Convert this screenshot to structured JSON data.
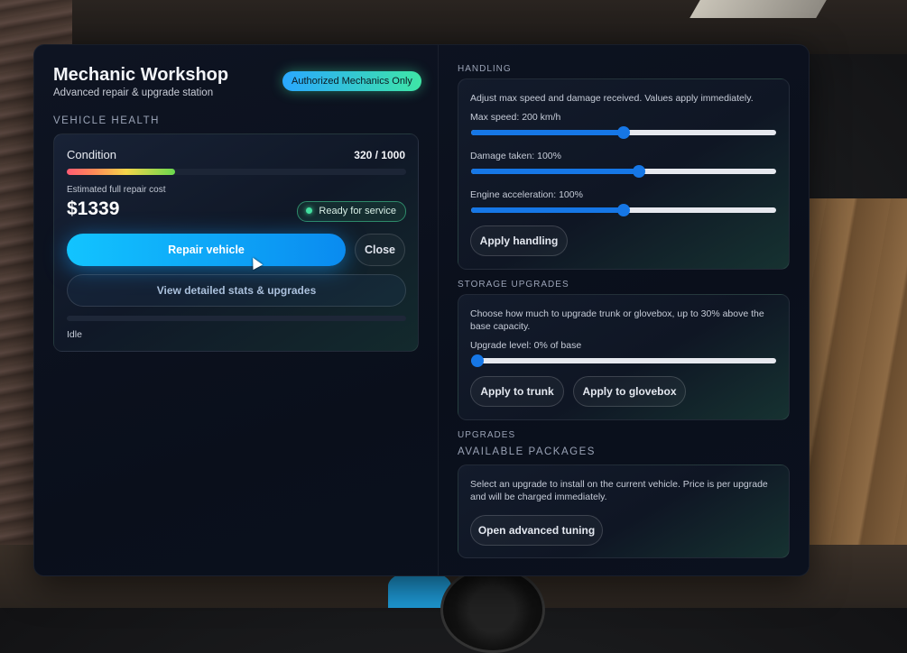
{
  "header": {
    "title": "Mechanic Workshop",
    "subtitle": "Advanced repair & upgrade station",
    "auth_badge": "Authorized Mechanics Only"
  },
  "vehicle_health": {
    "section_label": "VEHICLE HEALTH",
    "condition_label": "Condition",
    "condition_value": "320 / 1000",
    "condition_fraction": 0.32,
    "cost_label": "Estimated full repair cost",
    "cost_value": "$1339",
    "ready_badge": "Ready for service",
    "repair_button": "Repair vehicle",
    "close_button": "Close",
    "details_button": "View detailed stats & upgrades",
    "progress_fraction": 0.0,
    "status": "Idle"
  },
  "handling": {
    "section_label": "HANDLING",
    "close_glyph": "×",
    "description": "Adjust max speed and damage received. Values apply immediately.",
    "sliders": [
      {
        "label": "Max speed: 200 km/h",
        "fraction": 0.5
      },
      {
        "label": "Damage taken: 100%",
        "fraction": 0.55
      },
      {
        "label": "Engine acceleration: 100%",
        "fraction": 0.5
      }
    ],
    "apply_button": "Apply handling"
  },
  "storage": {
    "section_label": "STORAGE UPGRADES",
    "description": "Choose how much to upgrade trunk or glovebox, up to 30% above the base capacity.",
    "slider_label": "Upgrade level: 0% of base",
    "slider_fraction": 0.0,
    "trunk_button": "Apply to trunk",
    "glovebox_button": "Apply to glovebox"
  },
  "upgrades": {
    "section_label": "UPGRADES",
    "packages_label": "AVAILABLE PACKAGES",
    "description": "Select an upgrade to install on the current vehicle. Price is per upgrade and will be charged immediately.",
    "tuning_button": "Open advanced tuning"
  },
  "colors": {
    "accent": "#12c4ff",
    "slider": "#1677e6",
    "ready": "#43e0a0"
  }
}
